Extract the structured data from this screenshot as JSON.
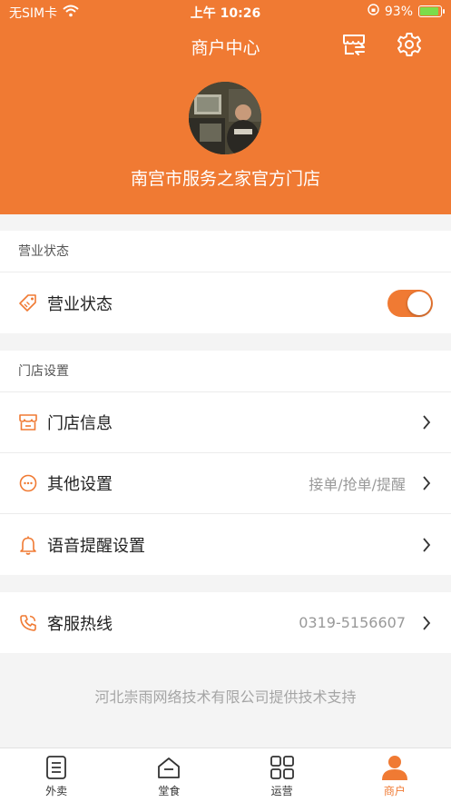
{
  "status_bar": {
    "carrier": "无SIM卡",
    "time": "上午 10:26",
    "battery": "93%",
    "battery_level": 0.93
  },
  "header": {
    "title": "商户中心",
    "shop_name": "南宫市服务之家官方门店",
    "store_icon": "store-switch-icon",
    "settings_icon": "gear-icon"
  },
  "business": {
    "section_title": "营业状态",
    "status_label": "营业状态",
    "status_on": true
  },
  "store_settings": {
    "section_title": "门店设置",
    "items": [
      {
        "label": "门店信息",
        "value": "",
        "icon": "storefront-icon"
      },
      {
        "label": "其他设置",
        "value": "接单/抢单/提醒",
        "icon": "more-circle-icon"
      },
      {
        "label": "语音提醒设置",
        "value": "",
        "icon": "bell-icon"
      }
    ]
  },
  "hotline": {
    "label": "客服热线",
    "value": "0319-5156607",
    "icon": "phone-icon"
  },
  "footer_note": "河北崇雨网络技术有限公司提供技术支持",
  "tabbar": {
    "tabs": [
      {
        "label": "外卖",
        "icon": "list-doc-icon",
        "active": false
      },
      {
        "label": "堂食",
        "icon": "dine-in-icon",
        "active": false
      },
      {
        "label": "运营",
        "icon": "grid-icon",
        "active": false
      },
      {
        "label": "商户",
        "icon": "person-icon",
        "active": true
      }
    ]
  },
  "colors": {
    "accent": "#f07a33",
    "background": "#f4f4f4"
  }
}
